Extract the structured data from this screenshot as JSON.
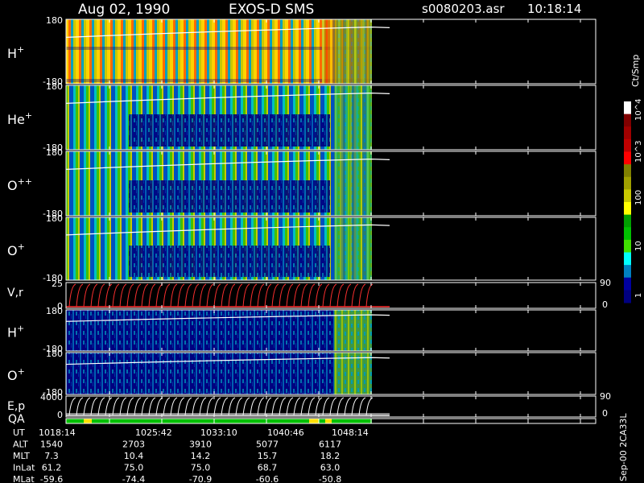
{
  "header": {
    "date": "Aug 02, 1990",
    "instrument": "EXOS-D SMS",
    "file": "s0080203.asr",
    "time": "10:18:14"
  },
  "colorbar": {
    "title": "Ct/Smp",
    "labels": [
      "10^4",
      "10^3",
      "100",
      "10",
      "1"
    ],
    "colors": [
      "#ffffff",
      "#800000",
      "#a00000",
      "#c00000",
      "#ff0000",
      "#808000",
      "#a0a000",
      "#c8c800",
      "#ffff00",
      "#00a000",
      "#00c000",
      "#40e000",
      "#00ffff",
      "#0080c0",
      "#0000a0",
      "#000080"
    ]
  },
  "footer": {
    "rows": [
      {
        "label": "UT",
        "values": [
          "1018:14",
          "1025:42",
          "1033:10",
          "1040:46",
          "1048:14"
        ]
      },
      {
        "label": "ALT",
        "values": [
          "1540",
          "2703",
          "3910",
          "5077",
          "6117"
        ]
      },
      {
        "label": "MLT",
        "values": [
          "7.3",
          "10.4",
          "14.2",
          "15.7",
          "18.2"
        ]
      },
      {
        "label": "InLat",
        "values": [
          "61.2",
          "75.0",
          "75.0",
          "68.7",
          "63.0"
        ]
      },
      {
        "label": "MLat",
        "values": [
          "-59.6",
          "-74.4",
          "-70.9",
          "-60.6",
          "-50.8"
        ]
      }
    ],
    "side_note": "Sep-00 2CA33L"
  },
  "chart_data": [
    {
      "type": "heatmap",
      "panel": "h_plus",
      "ylabel": "H+",
      "yticks": [
        "180",
        "-180"
      ],
      "ylim": [
        -180,
        180
      ]
    },
    {
      "type": "heatmap",
      "panel": "he_plus",
      "ylabel": "He+",
      "yticks": [
        "180",
        "-180"
      ],
      "ylim": [
        -180,
        180
      ]
    },
    {
      "type": "heatmap",
      "panel": "o_pp",
      "ylabel": "O++",
      "yticks": [
        "180",
        "-180"
      ],
      "ylim": [
        -180,
        180
      ]
    },
    {
      "type": "heatmap",
      "panel": "o_plus",
      "ylabel": "O+",
      "yticks": [
        "180",
        "-180"
      ],
      "ylim": [
        -180,
        180
      ]
    },
    {
      "type": "line",
      "panel": "vr",
      "ylabel": "V,r",
      "yticks": [
        "25",
        "0"
      ],
      "ylim": [
        0,
        25
      ],
      "y2ticks": [
        "90",
        "0"
      ]
    },
    {
      "type": "heatmap",
      "panel": "h_plus2",
      "ylabel": "H+",
      "yticks": [
        "180",
        "-180"
      ],
      "ylim": [
        -180,
        180
      ]
    },
    {
      "type": "heatmap",
      "panel": "o_plus2",
      "ylabel": "O+",
      "yticks": [
        "180",
        "-180"
      ],
      "ylim": [
        -180,
        180
      ]
    },
    {
      "type": "line",
      "panel": "ep",
      "ylabel": "E,p",
      "yticks": [
        "4000",
        "0"
      ],
      "ylim": [
        0,
        4000
      ],
      "y2ticks": [
        "90",
        "0"
      ]
    },
    {
      "type": "bar",
      "panel": "qa",
      "ylabel": "QA"
    }
  ]
}
